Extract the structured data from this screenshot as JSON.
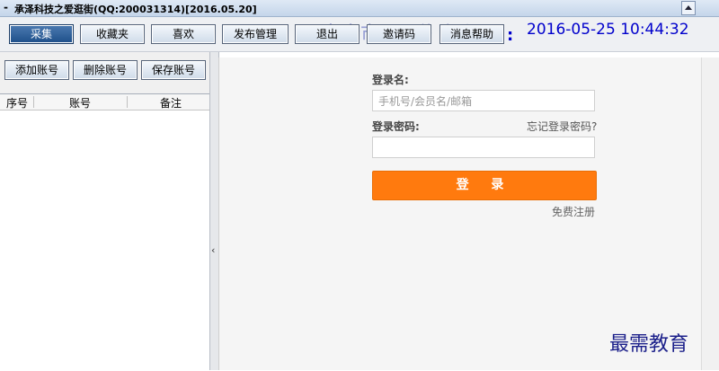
{
  "window": {
    "sysmenu": "-",
    "title": "承泽科技之爱逛街(QQ:200031314)[2016.05.20]"
  },
  "toolbar": {
    "buttons": [
      {
        "label": "采集",
        "active": true
      },
      {
        "label": "收藏夹"
      },
      {
        "label": "喜欢"
      },
      {
        "label": "发布管理"
      },
      {
        "label": "退出"
      },
      {
        "label": "邀请码"
      },
      {
        "label": "消息帮助"
      }
    ],
    "faint_text": "圣中全市 买 赚 上 源",
    "clock_separator": ":",
    "clock": "2016-05-25 10:44:32"
  },
  "left_panel": {
    "buttons": [
      "添加账号",
      "删除账号",
      "保存账号"
    ],
    "columns": [
      "序号",
      "账号",
      "备注"
    ],
    "collapse_glyph": "‹"
  },
  "login": {
    "username_label": "登录名:",
    "username_placeholder": "手机号/会员名/邮箱",
    "password_label": "登录密码:",
    "forgot_label": "忘记登录密码?",
    "submit_label": "登 录",
    "register_link": "免费注册"
  },
  "watermark": "最需教育",
  "colors": {
    "accent_orange": "#ff7a0e",
    "clock_blue": "#0000cc",
    "active_button": "#1d4f8a"
  }
}
